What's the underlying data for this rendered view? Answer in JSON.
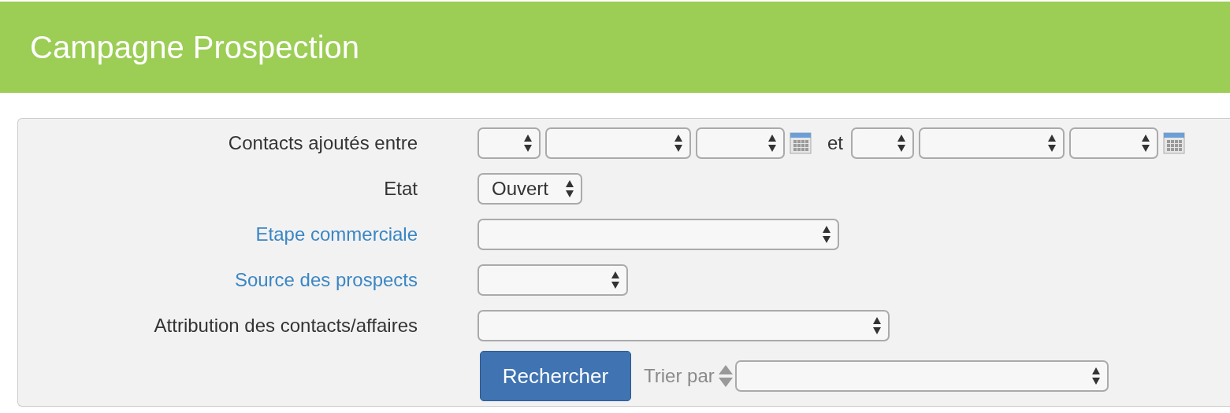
{
  "header": {
    "title": "Campagne Prospection"
  },
  "filters": [
    {
      "label": "Contacts ajoutés entre",
      "link": false,
      "kind": "date_range",
      "separator": "et"
    },
    {
      "label": "Etat",
      "link": false,
      "kind": "select",
      "value": "Ouvert"
    },
    {
      "label": "Etape commerciale",
      "link": true,
      "kind": "select"
    },
    {
      "label": "Source des prospects",
      "link": true,
      "kind": "select"
    },
    {
      "label": "Attribution des contacts/affaires",
      "link": false,
      "kind": "select"
    }
  ],
  "search_button": "Rechercher",
  "sort": {
    "label": "Trier par"
  }
}
